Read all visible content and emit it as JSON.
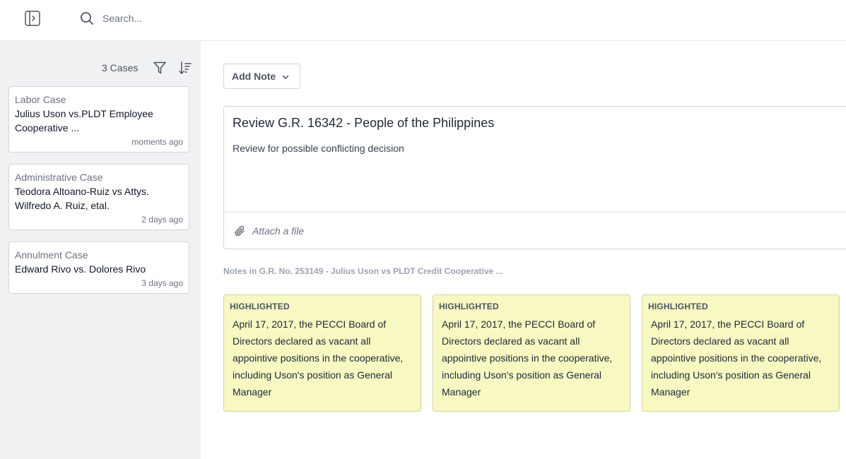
{
  "topbar": {
    "search_placeholder": "Search..."
  },
  "sidebar": {
    "case_count": "3 Cases",
    "cases": [
      {
        "type": "Labor Case",
        "title": "Julius Uson vs.PLDT Employee Cooperative ...",
        "time": "moments ago"
      },
      {
        "type": "Administrative Case",
        "title": "Teodora Altoano-Ruiz vs Attys. Wilfredo A. Ruiz, etal.",
        "time": "2 days ago"
      },
      {
        "type": "Annulment Case",
        "title": "Edward Rivo vs. Dolores Rivo",
        "time": "3 days ago"
      }
    ]
  },
  "main": {
    "add_note_label": "Add Note",
    "note": {
      "title": "Review G.R. 16342 - People of the Philippines",
      "body": "Review for possible conflicting decision",
      "attach_label": "Attach a file"
    },
    "notes_heading": "Notes in G.R. No. 253149 - Julius Uson vs PLDT Credit Cooperative ...",
    "highlights": [
      {
        "tag": "HIGHLIGHTED",
        "text": "April 17, 2017, the PECCI Board of Directors declared as vacant all appointive positions in the cooperative, including Uson's position as General Manager"
      },
      {
        "tag": "HIGHLIGHTED",
        "text": "April 17, 2017, the PECCI Board of Directors declared as vacant all appointive positions in the cooperative, including Uson's position as General Manager"
      },
      {
        "tag": "HIGHLIGHTED",
        "text": "April 17, 2017, the PECCI Board of Directors declared as vacant all appointive positions in the cooperative, including Uson's position as General Manager"
      }
    ]
  },
  "colors": {
    "highlight_bg": "#f7f8c2",
    "sidebar_bg": "#f0f1f3"
  }
}
